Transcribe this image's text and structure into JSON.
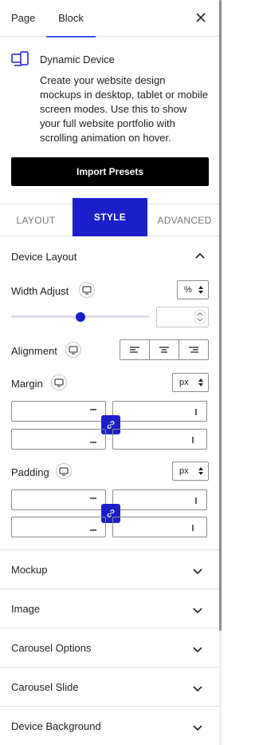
{
  "tabs": {
    "page": "Page",
    "block": "Block"
  },
  "block_card": {
    "title": "Dynamic Device",
    "description": "Create your website design mockups in desktop, tablet or mobile screen modes. Use this to show your full website portfolio with scrolling animation on hover.",
    "import_label": "Import Presets"
  },
  "style_tabs": {
    "layout": "LAYOUT",
    "style": "STYLE",
    "advanced": "ADVANCED"
  },
  "device_layout": {
    "title": "Device Layout",
    "width_label": "Width Adjust",
    "width_unit": "%",
    "width_slider_fraction": 0.5,
    "alignment_label": "Alignment",
    "margin_label": "Margin",
    "margin_unit": "px",
    "padding_label": "Padding",
    "padding_unit": "px"
  },
  "sections": [
    "Mockup",
    "Image",
    "Carousel Options",
    "Carousel Slide",
    "Device Background"
  ],
  "colors": {
    "accent": "#1b1fc9",
    "tab_underline": "#3858e9"
  }
}
